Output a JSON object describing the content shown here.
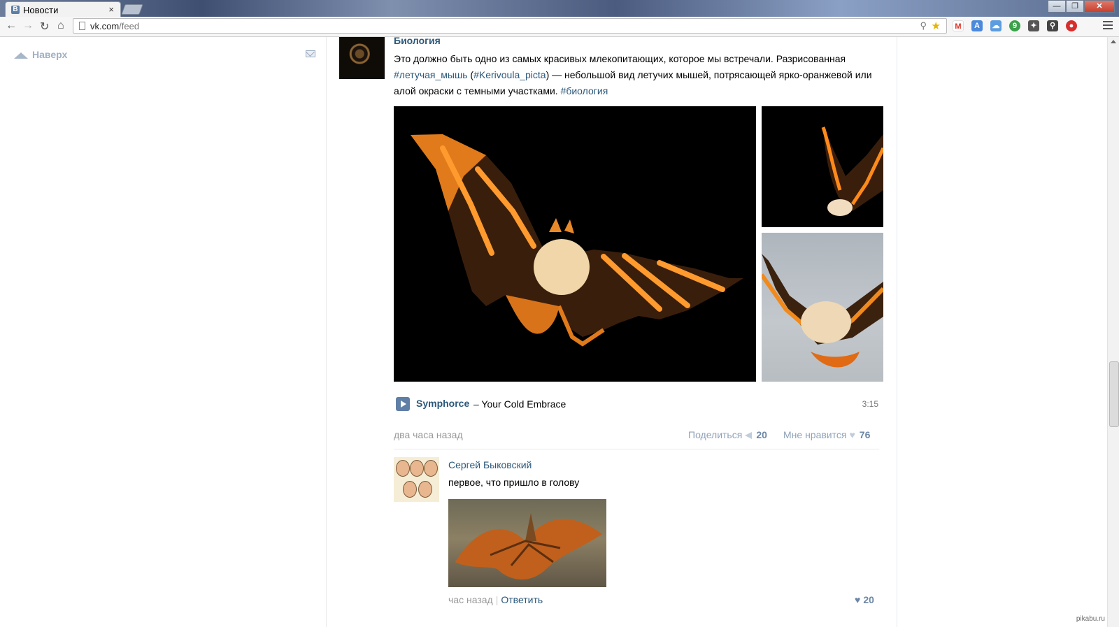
{
  "browser": {
    "tab_title": "Новости",
    "tab_close": "×",
    "url_host": "vk.com",
    "url_path": "/feed",
    "window_controls": [
      "—",
      "❐",
      "✕"
    ]
  },
  "sidebar": {
    "naverh_label": "Наверх"
  },
  "post": {
    "author": "Биология",
    "text_part1": "Это должно быть одно из самых красивых млекопитающих, которое мы встречали. Разрисованная ",
    "hashtag1": "#летучая_мышь",
    "text_part2": " (",
    "hashtag2": "#Kerivoula_picta",
    "text_part3": ") — небольшой вид летучих мышей, потрясающей ярко-оранжевой или алой окраски с темными участками. ",
    "hashtag3": "#биология",
    "audio": {
      "artist": "Symphorce",
      "title": "– Your Cold Embrace",
      "duration": "3:15"
    },
    "time": "два часа назад",
    "share_label": "Поделиться",
    "share_count": "20",
    "like_label": "Мне нравится",
    "like_count": "76"
  },
  "comment": {
    "author": "Сергей Быковский",
    "text": "первое, что пришло в голову",
    "time": "час назад",
    "separator": "|",
    "reply_label": "Ответить",
    "like_count": "20"
  },
  "watermark": "pikabu.ru",
  "icons": [
    "page-icon",
    "zoom-icon",
    "star-icon",
    "menu-icon",
    "mail-icon",
    "up-arrow-icon",
    "play-icon",
    "share-icon",
    "heart-icon"
  ]
}
